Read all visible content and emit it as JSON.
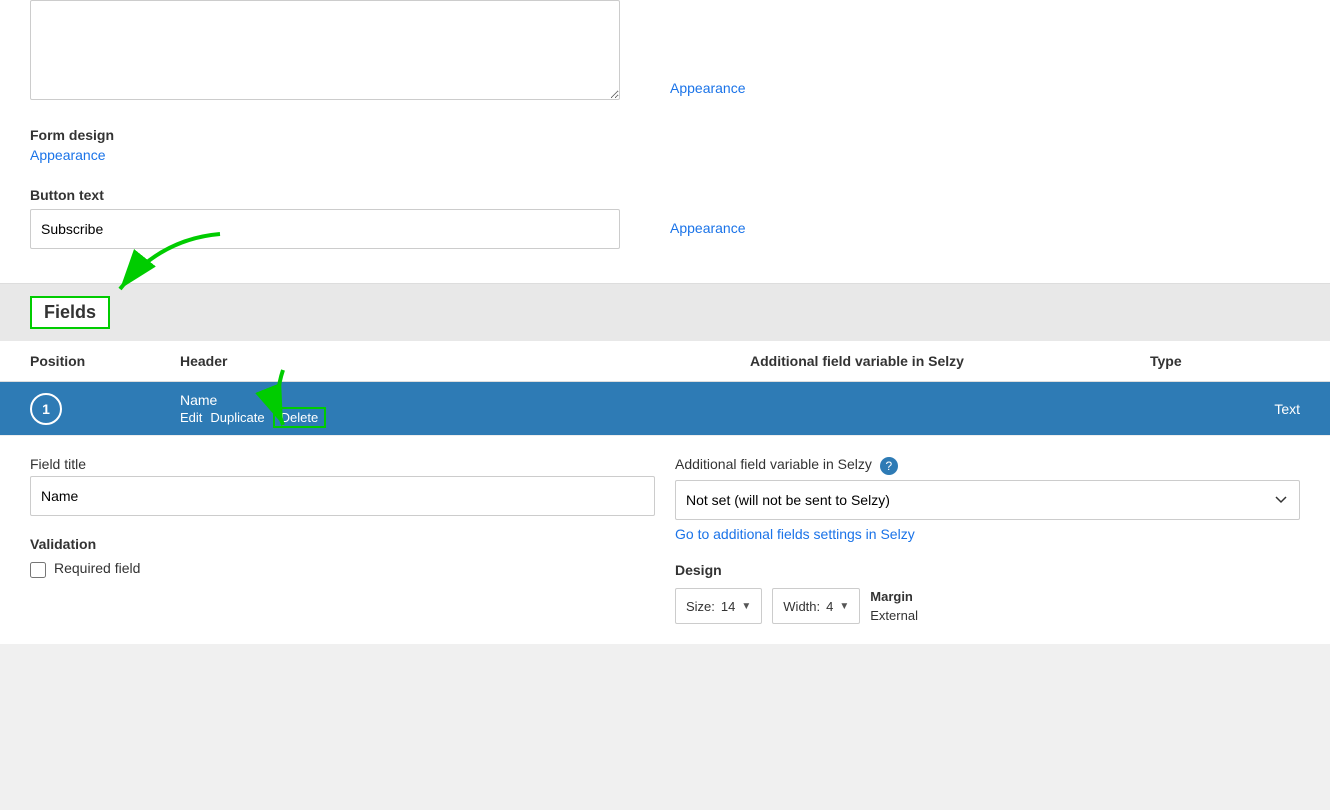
{
  "page": {
    "top": {
      "textarea_placeholder": "",
      "appearance1_label": "Appearance",
      "form_design_label": "Form design",
      "appearance2_label": "Appearance",
      "button_text_label": "Button text",
      "button_text_value": "Subscribe",
      "appearance3_label": "Appearance"
    },
    "fields_header": {
      "label": "Fields"
    },
    "table": {
      "col_position": "Position",
      "col_header": "Header",
      "col_additional": "Additional field variable in Selzy",
      "col_type": "Type"
    },
    "row1": {
      "position": "1",
      "name": "Name",
      "edit": "Edit",
      "duplicate": "Duplicate",
      "delete": "Delete",
      "type": "Text"
    },
    "detail": {
      "field_title_label": "Field title",
      "field_title_value": "Name",
      "additional_label": "Additional field variable in Selzy",
      "additional_select_value": "Not set (will not be sent to Selzy)",
      "selzy_link": "Go to additional fields settings in Selzy",
      "validation_label": "Validation",
      "required_field_label": "Required field",
      "design_label": "Design",
      "size_label": "Size:",
      "size_value": "14",
      "width_label": "Width:",
      "width_value": "4",
      "margin_label": "Margin",
      "margin_value": "External"
    }
  }
}
